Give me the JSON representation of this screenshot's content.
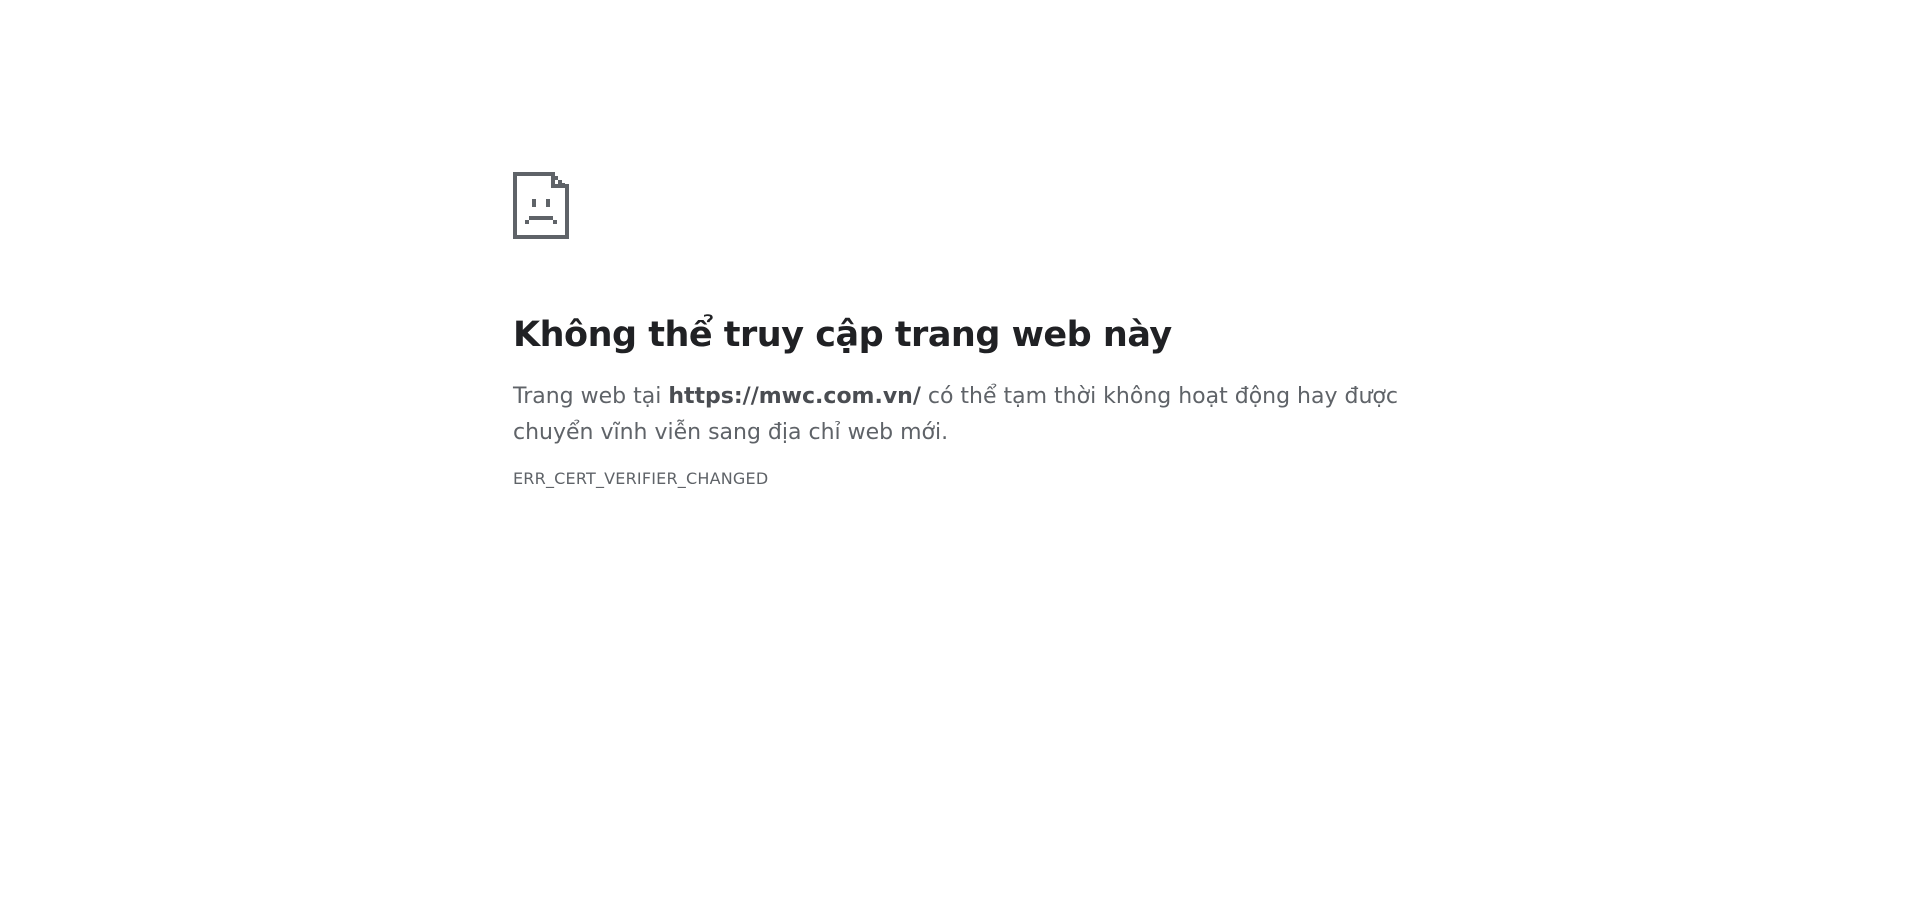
{
  "error": {
    "icon": "sad-document-icon",
    "title": "Không thể truy cập trang web này",
    "body_prefix": "Trang web tại ",
    "url": "https://mwc.com.vn/",
    "body_suffix": " có thể tạm thời không hoạt động hay được chuyển vĩnh viễn sang địa chỉ web mới.",
    "code": "ERR_CERT_VERIFIER_CHANGED"
  },
  "colors": {
    "background": "#ffffff",
    "title": "#202124",
    "body": "#5f6368",
    "icon": "#5f6368"
  }
}
